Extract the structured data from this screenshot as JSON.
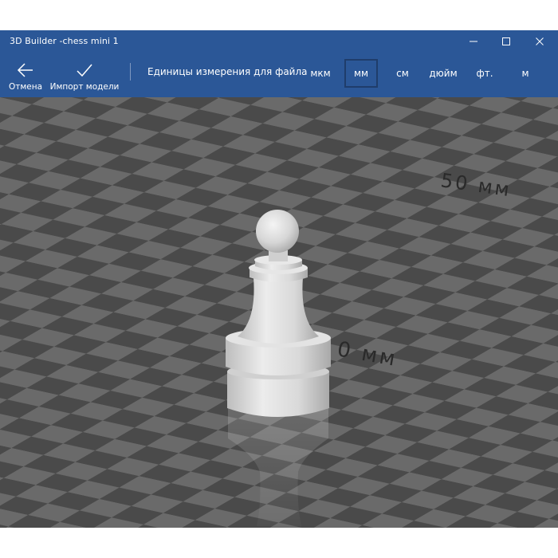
{
  "window": {
    "title": "3D Builder -chess mini 1"
  },
  "toolbar": {
    "cancel_label": "Отмена",
    "import_label": "Импорт модели",
    "units_label": "Единицы измерения для файла",
    "units": [
      {
        "label": "мкм",
        "selected": false
      },
      {
        "label": "мм",
        "selected": true
      },
      {
        "label": "см",
        "selected": false
      },
      {
        "label": "дюйм",
        "selected": false
      },
      {
        "label": "фт.",
        "selected": false
      },
      {
        "label": "м",
        "selected": false
      }
    ]
  },
  "viewport": {
    "grid_label_far": "50 мм",
    "grid_label_near": "0 мм",
    "model": "pawn"
  },
  "icons": {
    "back": "arrow-left-icon",
    "confirm": "checkmark-icon",
    "minimize": "minimize-icon",
    "maximize": "maximize-icon",
    "close": "close-icon"
  },
  "colors": {
    "accent": "#2b5797",
    "grid_light": "#6a6a6a",
    "grid_dark": "#4a4a4a"
  }
}
